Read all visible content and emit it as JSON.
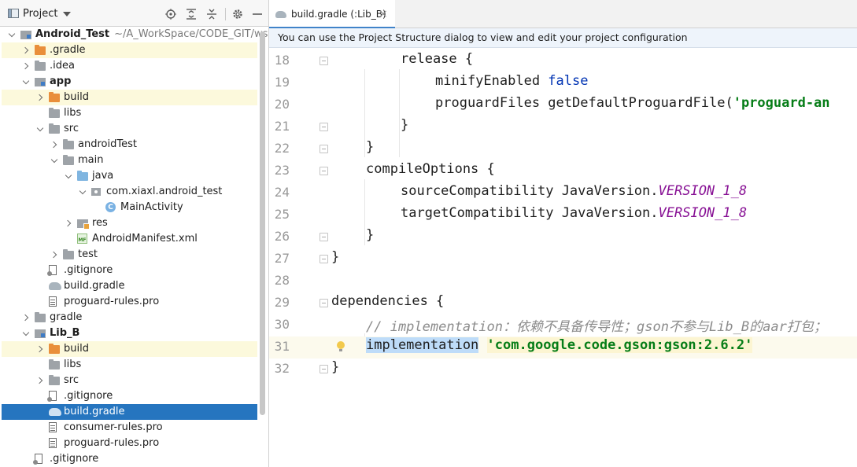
{
  "project_panel": {
    "title": "Project",
    "toolbar_icons": [
      "locate-icon",
      "expand-all-icon",
      "collapse-all-icon",
      "gear-icon",
      "hide-icon"
    ],
    "tree": [
      {
        "label": "Android_Test",
        "path": "~/A_WorkSpace/CODE_GIT/ws,",
        "icon": "module-icon",
        "arrow": "down",
        "bold": true
      },
      {
        "label": ".gradle",
        "icon": "folder-orange-icon",
        "arrow": "right"
      },
      {
        "label": ".idea",
        "icon": "folder-icon",
        "arrow": "right"
      },
      {
        "label": "app",
        "icon": "module-icon",
        "arrow": "down",
        "bold": true
      },
      {
        "label": "build",
        "icon": "folder-orange-icon",
        "arrow": "right"
      },
      {
        "label": "libs",
        "icon": "folder-icon"
      },
      {
        "label": "src",
        "icon": "folder-icon",
        "arrow": "down"
      },
      {
        "label": "androidTest",
        "icon": "folder-icon",
        "arrow": "right"
      },
      {
        "label": "main",
        "icon": "folder-icon",
        "arrow": "down"
      },
      {
        "label": "java",
        "icon": "folder-blue-icon",
        "arrow": "down"
      },
      {
        "label": "com.xiaxl.android_test",
        "icon": "package-icon",
        "arrow": "down"
      },
      {
        "label": "MainActivity",
        "icon": "class-icon",
        "glyph": "C"
      },
      {
        "label": "res",
        "icon": "res-folder-icon",
        "arrow": "right"
      },
      {
        "label": "AndroidManifest.xml",
        "icon": "manifest-icon",
        "glyph": "MF"
      },
      {
        "label": "test",
        "icon": "folder-icon",
        "arrow": "right"
      },
      {
        "label": ".gitignore",
        "icon": "gitignore-icon"
      },
      {
        "label": "build.gradle",
        "icon": "gradle-icon"
      },
      {
        "label": "proguard-rules.pro",
        "icon": "file-icon"
      },
      {
        "label": "gradle",
        "icon": "folder-icon",
        "arrow": "right"
      },
      {
        "label": "Lib_B",
        "icon": "module-icon",
        "arrow": "down",
        "bold": true
      },
      {
        "label": "build",
        "icon": "folder-orange-icon",
        "arrow": "right"
      },
      {
        "label": "libs",
        "icon": "folder-icon"
      },
      {
        "label": "src",
        "icon": "folder-icon",
        "arrow": "right"
      },
      {
        "label": ".gitignore",
        "icon": "gitignore-icon"
      },
      {
        "label": "build.gradle",
        "icon": "gradle-icon",
        "selected": true
      },
      {
        "label": "consumer-rules.pro",
        "icon": "file-icon"
      },
      {
        "label": "proguard-rules.pro",
        "icon": "file-icon"
      },
      {
        "label": ".gitignore",
        "icon": "gitignore-icon"
      }
    ]
  },
  "editor": {
    "tab": {
      "label": "build.gradle (:Lib_B)",
      "close": "×"
    },
    "notice": "You can use the Project Structure dialog to view and edit your project configuration",
    "lines": [
      {
        "num": "18",
        "tokens": [
          {
            "t": "release {",
            "c": ""
          }
        ]
      },
      {
        "num": "19",
        "tokens": [
          {
            "t": "minifyEnabled ",
            "c": ""
          },
          {
            "t": "false",
            "c": "kw"
          }
        ]
      },
      {
        "num": "20",
        "tokens": [
          {
            "t": "proguardFiles getDefaultProguardFile(",
            "c": ""
          },
          {
            "t": "'proguard-an",
            "c": "str"
          }
        ]
      },
      {
        "num": "21",
        "tokens": [
          {
            "t": "}",
            "c": ""
          }
        ]
      },
      {
        "num": "22",
        "tokens": [
          {
            "t": "}",
            "c": ""
          }
        ]
      },
      {
        "num": "23",
        "tokens": [
          {
            "t": "compileOptions {",
            "c": ""
          }
        ]
      },
      {
        "num": "24",
        "tokens": [
          {
            "t": "sourceCompatibility JavaVersion.",
            "c": ""
          },
          {
            "t": "VERSION_1_8",
            "c": "const"
          }
        ]
      },
      {
        "num": "25",
        "tokens": [
          {
            "t": "targetCompatibility JavaVersion.",
            "c": ""
          },
          {
            "t": "VERSION_1_8",
            "c": "const"
          }
        ]
      },
      {
        "num": "26",
        "tokens": [
          {
            "t": "}",
            "c": ""
          }
        ]
      },
      {
        "num": "27",
        "tokens": [
          {
            "t": "}",
            "c": ""
          }
        ]
      },
      {
        "num": "28",
        "tokens": []
      },
      {
        "num": "29",
        "tokens": [
          {
            "t": "dependencies {",
            "c": ""
          }
        ]
      },
      {
        "num": "30",
        "tokens": [
          {
            "t": "// implementation：依赖不具备传导性；gson不参与Lib_B的aar打包；",
            "c": "cmt"
          }
        ]
      },
      {
        "num": "31",
        "tokens": [
          {
            "t": "implementation",
            "c": "ident-hl"
          },
          {
            "t": " ",
            "c": ""
          },
          {
            "t": "'com.google.code.gson:gson:2.6.2'",
            "c": "str str-hl"
          }
        ]
      },
      {
        "num": "32",
        "tokens": [
          {
            "t": "}",
            "c": ""
          }
        ]
      }
    ]
  },
  "colors": {
    "selection": "#2675bf",
    "highlight_row": "#fcf9dc",
    "keyword": "#0033b3",
    "string": "#067d17",
    "constant": "#871094",
    "comment": "#8c8c8c"
  }
}
